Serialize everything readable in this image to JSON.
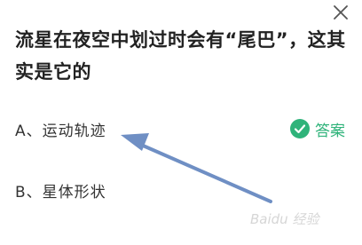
{
  "question": {
    "text": "流星在夜空中划过时会有“尾巴”，这其实是它的"
  },
  "options": [
    {
      "label": "A、运动轨迹",
      "is_answer": true
    },
    {
      "label": "B、星体形状",
      "is_answer": false
    }
  ],
  "answer_badge": {
    "text": "答案",
    "icon": "check-circle-icon",
    "color": "#2fb37a"
  },
  "close_icon": "close-icon",
  "watermark": {
    "text": "Baidu 经验"
  },
  "colors": {
    "arrow": "#6f8fc4",
    "question": "#222222",
    "option": "#333333"
  }
}
